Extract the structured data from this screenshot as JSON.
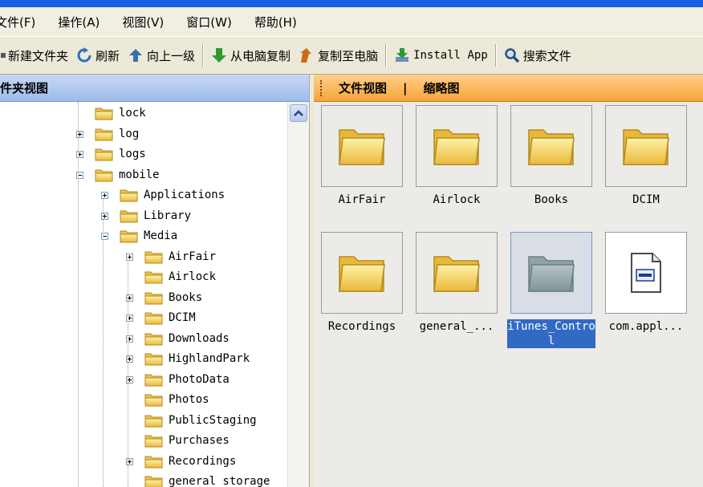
{
  "menu": [
    "文件(F)",
    "操作(A)",
    "视图(V)",
    "窗口(W)",
    "帮助(H)"
  ],
  "toolbar": {
    "new_folder": "新建文件夹",
    "refresh": "刷新",
    "up_level": "向上一级",
    "copy_from_pc": "从电脑复制",
    "copy_to_pc": "复制至电脑",
    "install_app": "Install App",
    "search": "搜索文件"
  },
  "tree": {
    "header": "文件夹视图",
    "items": [
      {
        "label": "lock",
        "level": 3,
        "expander": "none"
      },
      {
        "label": "log",
        "level": 3,
        "expander": "plus"
      },
      {
        "label": "logs",
        "level": 3,
        "expander": "plus"
      },
      {
        "label": "mobile",
        "level": 3,
        "expander": "minus",
        "open": true
      },
      {
        "label": "Applications",
        "level": 4,
        "expander": "plus"
      },
      {
        "label": "Library",
        "level": 4,
        "expander": "plus"
      },
      {
        "label": "Media",
        "level": 4,
        "expander": "minus",
        "open": true
      },
      {
        "label": "AirFair",
        "level": 5,
        "expander": "plus"
      },
      {
        "label": "Airlock",
        "level": 5,
        "expander": "none"
      },
      {
        "label": "Books",
        "level": 5,
        "expander": "plus"
      },
      {
        "label": "DCIM",
        "level": 5,
        "expander": "plus"
      },
      {
        "label": "Downloads",
        "level": 5,
        "expander": "plus"
      },
      {
        "label": "HighlandPark",
        "level": 5,
        "expander": "plus"
      },
      {
        "label": "PhotoData",
        "level": 5,
        "expander": "plus"
      },
      {
        "label": "Photos",
        "level": 5,
        "expander": "none"
      },
      {
        "label": "PublicStaging",
        "level": 5,
        "expander": "none"
      },
      {
        "label": "Purchases",
        "level": 5,
        "expander": "none"
      },
      {
        "label": "Recordings",
        "level": 5,
        "expander": "plus"
      },
      {
        "label": "general_storage",
        "level": 5,
        "expander": "none"
      }
    ]
  },
  "files": {
    "tab_file_view": "文件视图",
    "separator": "|",
    "tab_thumbnail": "缩略图",
    "tiles": [
      {
        "label": "AirFair",
        "kind": "folder"
      },
      {
        "label": "Airlock",
        "kind": "folder"
      },
      {
        "label": "Books",
        "kind": "folder"
      },
      {
        "label": "DCIM",
        "kind": "folder"
      },
      {
        "label": "Recordings",
        "kind": "folder"
      },
      {
        "label": "general_...",
        "kind": "folder"
      },
      {
        "label": "iTunes_Control",
        "kind": "folder-gray",
        "selected": true
      },
      {
        "label": "com.appl...",
        "kind": "file"
      }
    ]
  },
  "colors": {
    "title_blue": "#1660e8",
    "tree_header": "#9ebbe9",
    "right_header": "#f7a43b",
    "folder_yellow": "#f6d35c",
    "selection": "#316ac5"
  }
}
